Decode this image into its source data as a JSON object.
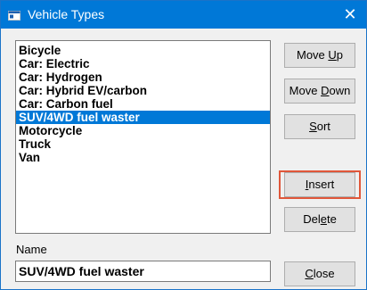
{
  "window": {
    "title": "Vehicle Types",
    "close_glyph": "✕",
    "colors": {
      "titlebar": "#0078d7",
      "selection": "#0078d7",
      "highlight": "#e0573a"
    }
  },
  "list": {
    "items": [
      {
        "label": "Bicycle",
        "selected": false
      },
      {
        "label": "Car: Electric",
        "selected": false
      },
      {
        "label": "Car: Hydrogen",
        "selected": false
      },
      {
        "label": "Car: Hybrid EV/carbon",
        "selected": false
      },
      {
        "label": "Car: Carbon fuel",
        "selected": false
      },
      {
        "label": "SUV/4WD fuel waster",
        "selected": true
      },
      {
        "label": "Motorcycle",
        "selected": false
      },
      {
        "label": "Truck",
        "selected": false
      },
      {
        "label": "Van",
        "selected": false
      }
    ]
  },
  "name_field": {
    "label": "Name",
    "value": "SUV/4WD fuel waster"
  },
  "buttons": {
    "move_up": {
      "pre": "Move ",
      "ul": "U",
      "post": "p"
    },
    "move_down": {
      "pre": "Move ",
      "ul": "D",
      "post": "own"
    },
    "sort": {
      "pre": "",
      "ul": "S",
      "post": "ort"
    },
    "insert": {
      "pre": "",
      "ul": "I",
      "post": "nsert"
    },
    "delete": {
      "pre": "Del",
      "ul": "e",
      "post": "te"
    },
    "close": {
      "pre": "",
      "ul": "C",
      "post": "lose"
    }
  },
  "icons": {
    "app": "window-app-icon",
    "close": "close-icon"
  }
}
